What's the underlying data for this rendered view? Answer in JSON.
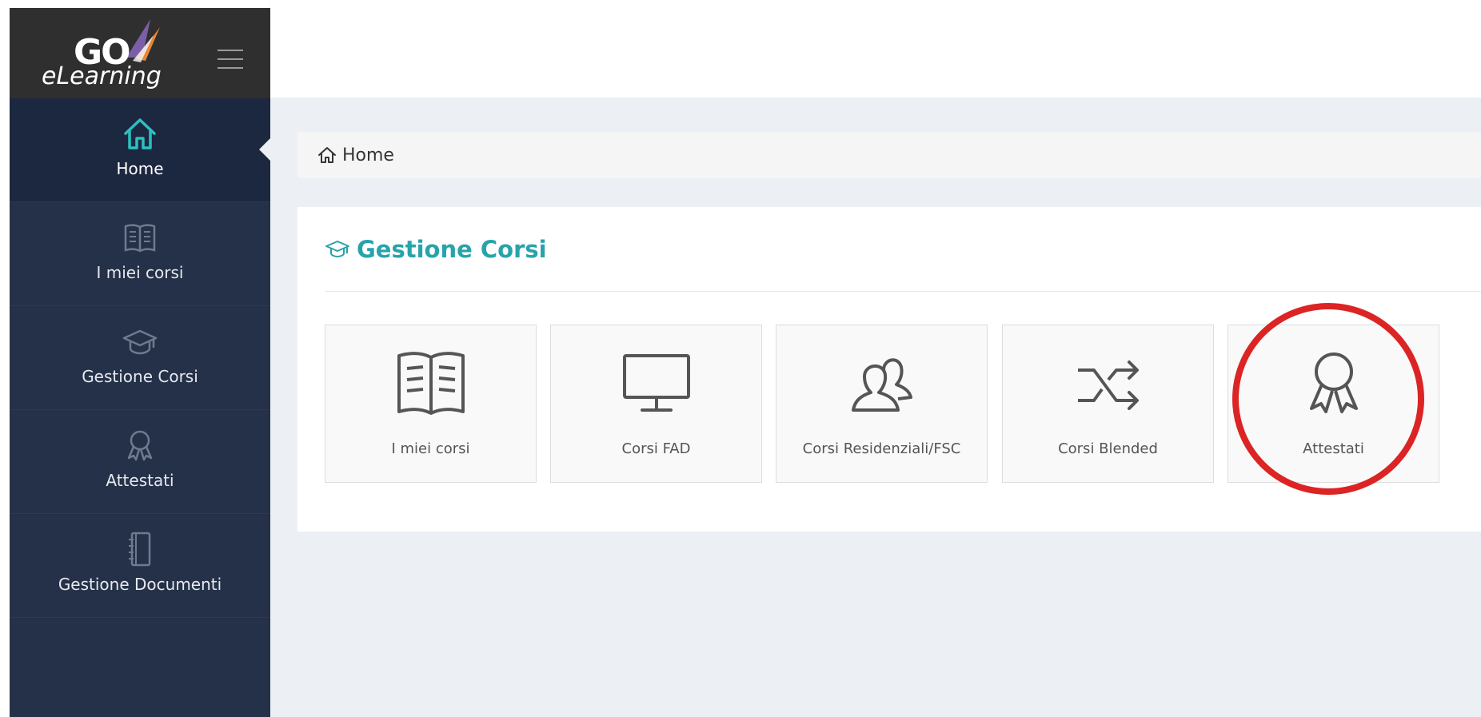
{
  "logo": {
    "go_text": "GO",
    "product_text": "eLearning",
    "brand_colors": [
      "#7b5ea7",
      "#e8863a",
      "#ffffff"
    ]
  },
  "sidebar": {
    "background": "#253148",
    "items": [
      {
        "label": "Home",
        "icon": "home-icon",
        "active": true
      },
      {
        "label": "I miei corsi",
        "icon": "book-icon",
        "active": false
      },
      {
        "label": "Gestione Corsi",
        "icon": "graduation-cap-icon",
        "active": false
      },
      {
        "label": "Attestati",
        "icon": "award-icon",
        "active": false
      },
      {
        "label": "Gestione Documenti",
        "icon": "notebook-icon",
        "active": false
      }
    ]
  },
  "breadcrumb": {
    "icon": "home-icon",
    "label": "Home"
  },
  "panel": {
    "title": "Gestione Corsi",
    "title_icon": "graduation-cap-icon",
    "title_color": "#27a3ab"
  },
  "tiles": [
    {
      "label": "I miei corsi",
      "icon": "book-icon"
    },
    {
      "label": "Corsi FAD",
      "icon": "monitor-icon"
    },
    {
      "label": "Corsi Residenziali/FSC",
      "icon": "users-icon"
    },
    {
      "label": "Corsi Blended",
      "icon": "shuffle-icon"
    },
    {
      "label": "Attestati",
      "icon": "award-icon"
    }
  ],
  "annotation": {
    "highlight_color": "#dc2424",
    "highlighted_tile": "Attestati"
  }
}
